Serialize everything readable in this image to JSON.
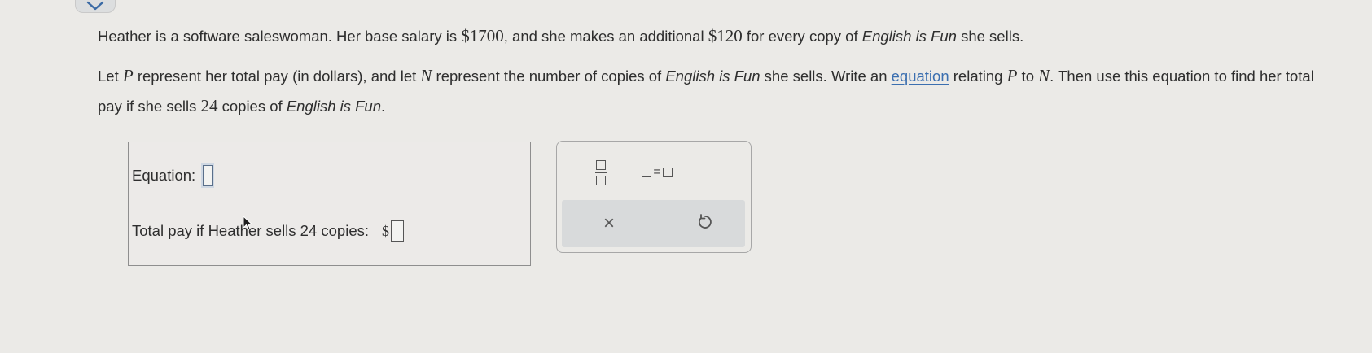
{
  "header": {
    "toggle_icon": "chevron-down-icon"
  },
  "problem": {
    "line1": {
      "part1": "Heather is a software saleswoman. Her base salary is ",
      "salary": "$1700",
      "part2": ", and she makes an additional ",
      "rate": "$120",
      "part3": " for every copy of ",
      "book": "English is Fun",
      "part4": " she sells."
    },
    "line2": {
      "part1": "Let ",
      "var_p": "P",
      "part2": " represent her total pay (in dollars), and let ",
      "var_n": "N",
      "part3": " represent the number of copies of ",
      "book": "English is Fun",
      "part4": " she sells. Write an ",
      "link": "equation",
      "part5": " relating ",
      "var_p2": "P",
      "part6": " to ",
      "var_n2": "N",
      "part7": ". Then use this equation to find her total pay if she sells ",
      "copies": "24",
      "part8": " copies of ",
      "book2": "English is Fun",
      "part9": "."
    }
  },
  "answer": {
    "equation_label": "Equation:",
    "equation_value": "",
    "pay_label": "Total pay if Heather sells 24 copies:",
    "pay_prefix": "$",
    "pay_value": ""
  },
  "toolbar": {
    "fraction_icon": "fraction-icon",
    "equation_icon": "box-equals-box-icon",
    "equals_sign": "=",
    "clear_icon": "close-icon",
    "clear_glyph": "×",
    "undo_icon": "undo-icon"
  },
  "colors": {
    "background": "#ebeae7",
    "link": "#3b6fb0",
    "action_bar": "#d8dadb"
  }
}
